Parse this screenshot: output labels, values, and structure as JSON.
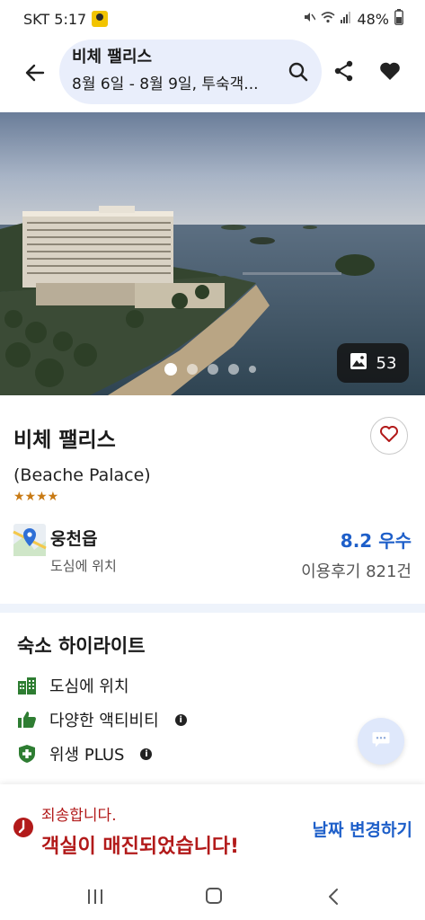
{
  "status_bar": {
    "carrier_time": "SKT 5:17",
    "battery": "48%"
  },
  "header": {
    "hotel_name": "비체 팰리스",
    "dates_guests": "8월 6일 - 8월 9일, 투숙객..."
  },
  "hero": {
    "photo_count": "53",
    "dots": 5,
    "active_dot": 0
  },
  "hotel": {
    "name_ko": "비체 팰리스",
    "name_en": "(Beache Palace)",
    "stars": 4,
    "stars_text": "★★★★",
    "location": "웅천읍",
    "location_sub": "도심에 위치",
    "rating": "8.2 우수",
    "reviews": "이용후기 821건"
  },
  "highlights": {
    "title": "숙소 하이라이트",
    "items": [
      {
        "label": "도심에 위치",
        "icon": "city-building-icon",
        "info": false
      },
      {
        "label": "다양한 액티비티",
        "icon": "thumbs-up-icon",
        "info": true
      },
      {
        "label": "위생 PLUS",
        "icon": "shield-plus-icon",
        "info": true
      }
    ]
  },
  "banner": {
    "sorry": "죄송합니다.",
    "soldout": "객실이 매진되었습니다!",
    "change_dates": "날짜 변경하기"
  },
  "colors": {
    "accent_blue": "#1e5fc9",
    "alert_red": "#b21a1a",
    "star_orange": "#c87a14",
    "search_bg": "#e9eefb"
  }
}
